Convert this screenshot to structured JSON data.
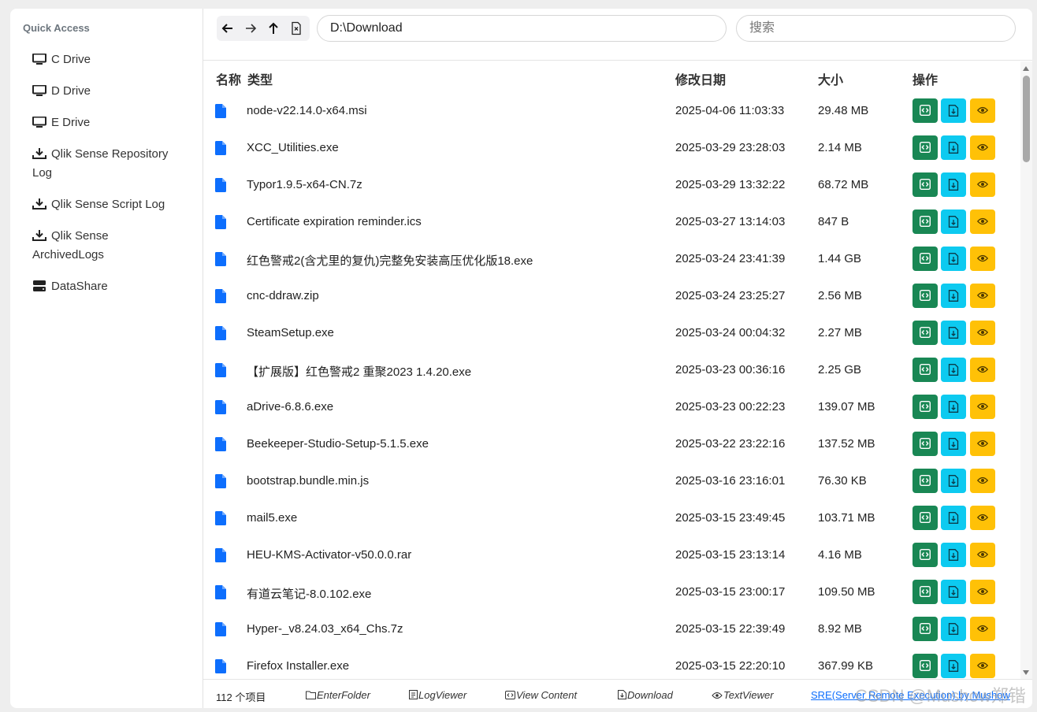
{
  "sidebar": {
    "title": "Quick Access",
    "items": [
      {
        "label": "C Drive",
        "icon": "monitor-icon"
      },
      {
        "label": "D Drive",
        "icon": "monitor-icon"
      },
      {
        "label": "E Drive",
        "icon": "monitor-icon"
      },
      {
        "label": "Qlik Sense Repository Log",
        "icon": "download-icon"
      },
      {
        "label": "Qlik Sense Script Log",
        "icon": "download-icon"
      },
      {
        "label": "Qlik Sense ArchivedLogs",
        "icon": "download-icon"
      },
      {
        "label": "DataShare",
        "icon": "server-icon"
      }
    ]
  },
  "toolbar": {
    "path_value": "D:\\Download",
    "search_placeholder": "搜索"
  },
  "table": {
    "headers": {
      "name": "名称",
      "type": "类型",
      "modified": "修改日期",
      "size": "大小",
      "actions": "操作"
    },
    "rows": [
      {
        "name": "node-v22.14.0-x64.msi",
        "date": "2025-04-06 11:03:33",
        "size": "29.48 MB"
      },
      {
        "name": "XCC_Utilities.exe",
        "date": "2025-03-29 23:28:03",
        "size": "2.14 MB"
      },
      {
        "name": "Typor1.9.5-x64-CN.7z",
        "date": "2025-03-29 13:32:22",
        "size": "68.72 MB"
      },
      {
        "name": "Certificate expiration reminder.ics",
        "date": "2025-03-27 13:14:03",
        "size": "847 B"
      },
      {
        "name": "红色警戒2(含尤里的复仇)完整免安装高压优化版18.exe",
        "date": "2025-03-24 23:41:39",
        "size": "1.44 GB"
      },
      {
        "name": "cnc-ddraw.zip",
        "date": "2025-03-24 23:25:27",
        "size": "2.56 MB"
      },
      {
        "name": "SteamSetup.exe",
        "date": "2025-03-24 00:04:32",
        "size": "2.27 MB"
      },
      {
        "name": "【扩展版】红色警戒2 重聚2023 1.4.20.exe",
        "date": "2025-03-23 00:36:16",
        "size": "2.25 GB"
      },
      {
        "name": "aDrive-6.8.6.exe",
        "date": "2025-03-23 00:22:23",
        "size": "139.07 MB"
      },
      {
        "name": "Beekeeper-Studio-Setup-5.1.5.exe",
        "date": "2025-03-22 23:22:16",
        "size": "137.52 MB"
      },
      {
        "name": "bootstrap.bundle.min.js",
        "date": "2025-03-16 23:16:01",
        "size": "76.30 KB"
      },
      {
        "name": "mail5.exe",
        "date": "2025-03-15 23:49:45",
        "size": "103.71 MB"
      },
      {
        "name": "HEU-KMS-Activator-v50.0.0.rar",
        "date": "2025-03-15 23:13:14",
        "size": "4.16 MB"
      },
      {
        "name": "有道云笔记-8.0.102.exe",
        "date": "2025-03-15 23:00:17",
        "size": "109.50 MB"
      },
      {
        "name": "Hyper-_v8.24.03_x64_Chs.7z",
        "date": "2025-03-15 22:39:49",
        "size": "8.92 MB"
      },
      {
        "name": "Firefox Installer.exe",
        "date": "2025-03-15 22:20:10",
        "size": "367.99 KB"
      }
    ]
  },
  "status": {
    "count": "112 个项目",
    "legend": {
      "enter_folder": "EnterFolder",
      "log_viewer": "LogViewer",
      "view_content": "View Content",
      "download": "Download",
      "text_viewer": "TextViewer"
    },
    "credit": "SRE(Server Remote Execution) by Mushow"
  },
  "watermark": "CSDN @Mushow郑锴",
  "colors": {
    "open_button": "#198754",
    "download_button": "#0dcaf0",
    "view_button": "#ffc107",
    "file_icon": "#0d6efd",
    "link": "#0d6efd"
  }
}
